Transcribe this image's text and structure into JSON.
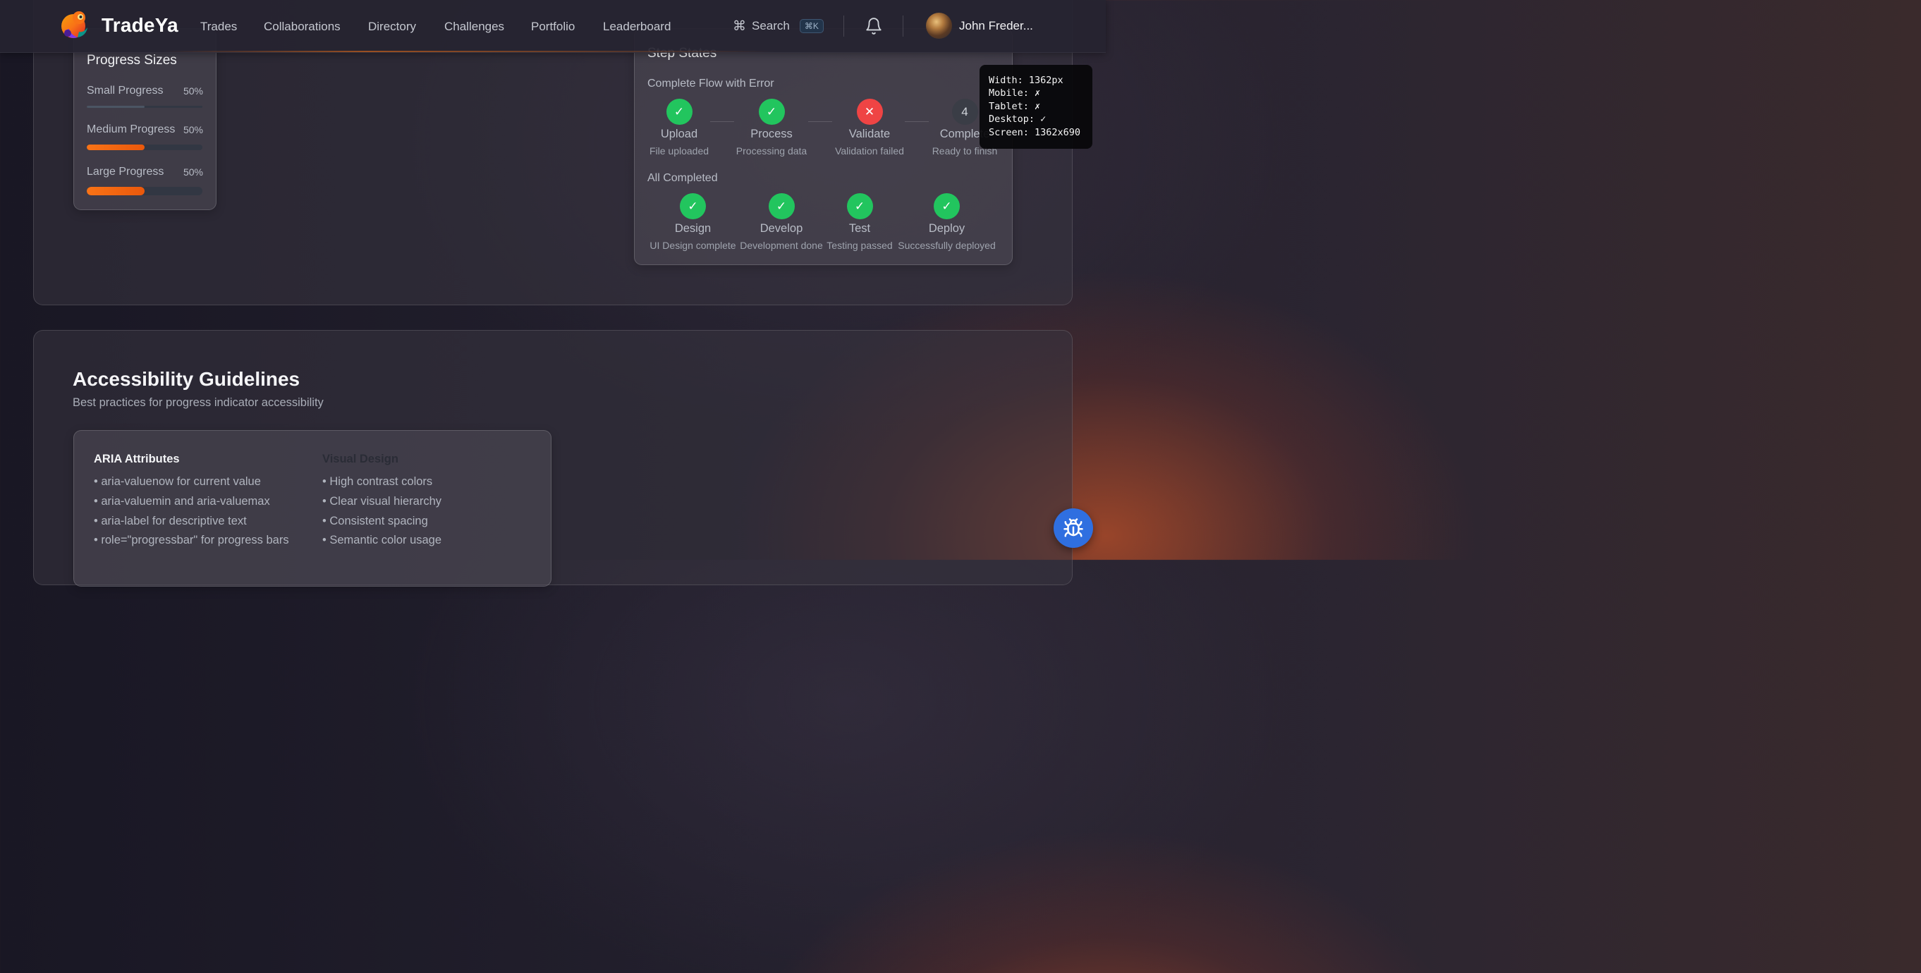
{
  "nav": {
    "brand": "TradeYa",
    "links": [
      "Trades",
      "Collaborations",
      "Directory",
      "Challenges",
      "Portfolio",
      "Leaderboard"
    ],
    "search_label": "Search",
    "search_shortcut": "⌘K",
    "user_name": "John Freder..."
  },
  "progress_sizes": {
    "title": "Progress Sizes",
    "items": [
      {
        "label": "Small Progress",
        "value": "50%",
        "fraction": 0.5
      },
      {
        "label": "Medium Progress",
        "value": "50%",
        "fraction": 0.5
      },
      {
        "label": "Large Progress",
        "value": "50%",
        "fraction": 0.5
      }
    ]
  },
  "step_states": {
    "title": "Step States",
    "groups": [
      {
        "title": "Complete Flow with Error",
        "steps": [
          {
            "name": "Upload",
            "desc": "File uploaded",
            "state": "complete"
          },
          {
            "name": "Process",
            "desc": "Processing data",
            "state": "complete"
          },
          {
            "name": "Validate",
            "desc": "Validation failed",
            "state": "error"
          },
          {
            "name": "Complete",
            "desc": "Ready to finish",
            "state": "pending",
            "number": "4"
          }
        ]
      },
      {
        "title": "All Completed",
        "steps": [
          {
            "name": "Design",
            "desc": "UI Design complete",
            "state": "complete"
          },
          {
            "name": "Develop",
            "desc": "Development done",
            "state": "complete"
          },
          {
            "name": "Test",
            "desc": "Testing passed",
            "state": "complete"
          },
          {
            "name": "Deploy",
            "desc": "Successfully deployed",
            "state": "complete"
          }
        ]
      }
    ]
  },
  "accessibility": {
    "title": "Accessibility Guidelines",
    "subtitle": "Best practices for progress indicator accessibility",
    "columns": [
      {
        "title": "ARIA Attributes",
        "items": [
          "• aria-valuenow for current value",
          "• aria-valuemin and aria-valuemax",
          "• aria-label for descriptive text",
          "• role=\"progressbar\" for progress bars"
        ]
      },
      {
        "title": "Visual Design",
        "items": [
          "• High contrast colors",
          "• Clear visual hierarchy",
          "• Consistent spacing",
          "• Semantic color usage"
        ]
      }
    ]
  },
  "dev_tooltip": {
    "lines": [
      "Width: 1362px",
      "Mobile: ✗",
      "Tablet: ✗",
      "Desktop: ✓",
      "Screen: 1362x690"
    ]
  },
  "colors": {
    "accent": "#f97316",
    "success": "#22c55e",
    "error": "#ef4444",
    "pending": "#3a3d46",
    "fab": "#2f6fe0"
  },
  "icons": {
    "search": "command-icon",
    "notifications": "bell-icon",
    "fab": "bug-icon"
  }
}
